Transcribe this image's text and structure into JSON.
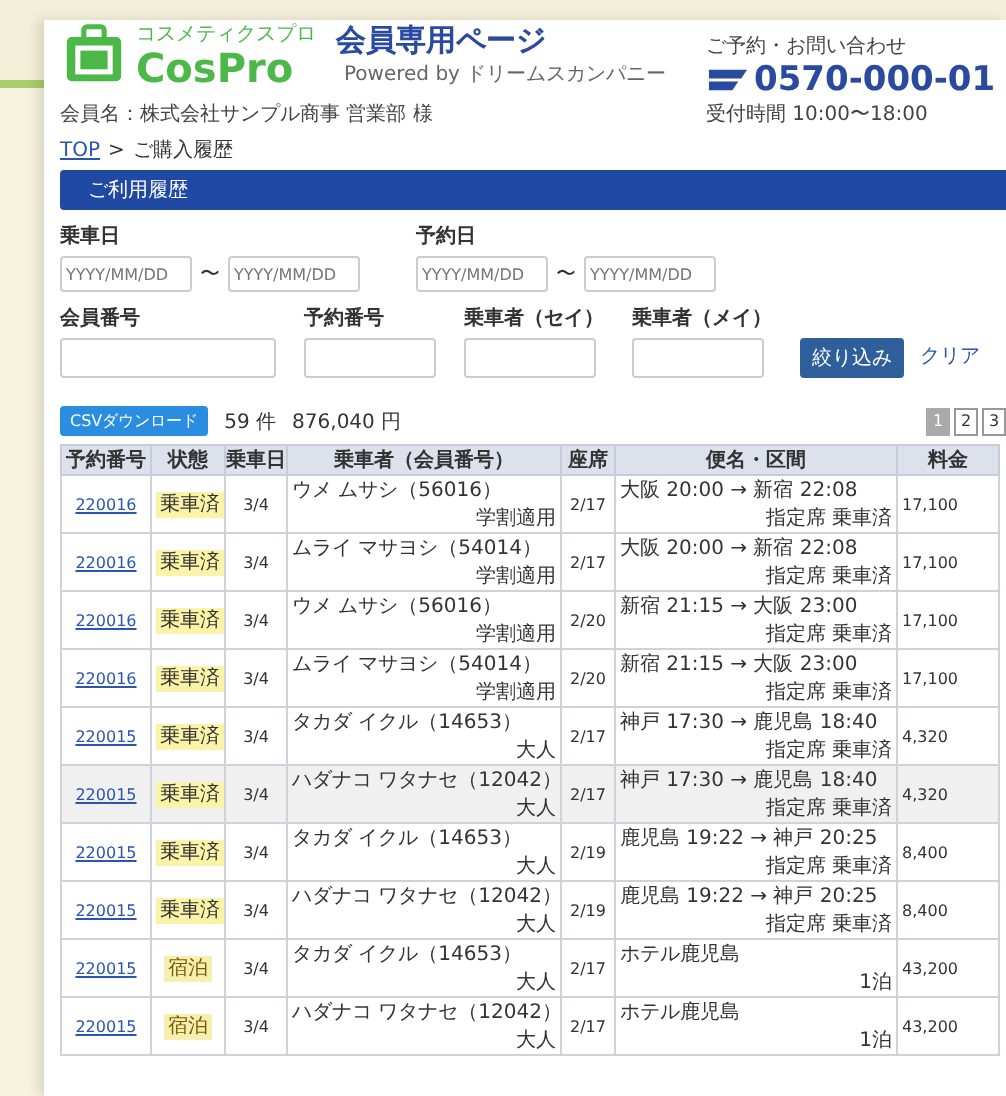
{
  "header": {
    "logo_tagline": "コスメティクスプロ",
    "logo": "CosPro",
    "title": "会員専用ページ",
    "powered": "Powered by ドリームスカンパニー",
    "member": "会員名：株式会社サンプル商事 営業部 様",
    "contact_label": "ご予約・お問い合わせ",
    "phone": "0570-000-01",
    "contact_note": "受付時間 10:00〜18:00"
  },
  "breadcrumb": [
    {
      "label": "TOP",
      "link": true
    },
    {
      "label": "ご購入履歴",
      "link": false
    }
  ],
  "breadcrumb_separator": ">",
  "section_title": "ご利用履歴",
  "filters": {
    "date_groups": [
      {
        "label": "乗車日",
        "from": {
          "placeholder": "YYYY/MM/DD"
        },
        "sep": "〜",
        "to": {
          "placeholder": "YYYY/MM/DD"
        }
      },
      {
        "label": "予約日",
        "from": {
          "placeholder": "YYYY/MM/DD"
        },
        "sep": "〜",
        "to": {
          "placeholder": "YYYY/MM/DD"
        }
      }
    ],
    "text_fields": [
      {
        "label": "会員番号"
      },
      {
        "label": "予約番号"
      },
      {
        "label": "乗車者（セイ）"
      },
      {
        "label": "乗車者（メイ）"
      }
    ],
    "search_button": "絞り込み",
    "clear_link": "クリア"
  },
  "summary": {
    "export_button": "CSVダウンロード",
    "count": "59 件",
    "total": "876,040 円"
  },
  "pagination": [
    {
      "label": "1",
      "selected": true
    },
    {
      "label": "2",
      "selected": false
    },
    {
      "label": "3",
      "selected": false
    }
  ],
  "table": {
    "columns": [
      "予約番号",
      "状態",
      "乗車日",
      "乗車者（会員番号）",
      "座席",
      "便名・区間",
      "料金"
    ],
    "rows": [
      {
        "id": "220016",
        "status": "乗車済",
        "kind": "done",
        "date": "3/4",
        "name": "ウメ ムサシ（56016）",
        "tag": "学割適用",
        "seat": "2/17",
        "route": "大阪 20:00 → 新宿 22:08",
        "route_note": "指定席 乗車済",
        "fare": "17,100",
        "highlighted": false
      },
      {
        "id": "220016",
        "status": "乗車済",
        "kind": "done",
        "date": "3/4",
        "name": "ムライ マサヨシ（54014）",
        "tag": "学割適用",
        "seat": "2/17",
        "route": "大阪 20:00 → 新宿 22:08",
        "route_note": "指定席 乗車済",
        "fare": "17,100",
        "highlighted": false
      },
      {
        "id": "220016",
        "status": "乗車済",
        "kind": "done",
        "date": "3/4",
        "name": "ウメ ムサシ（56016）",
        "tag": "学割適用",
        "seat": "2/20",
        "route": "新宿 21:15 → 大阪 23:00",
        "route_note": "指定席 乗車済",
        "fare": "17,100",
        "highlighted": false
      },
      {
        "id": "220016",
        "status": "乗車済",
        "kind": "done",
        "date": "3/4",
        "name": "ムライ マサヨシ（54014）",
        "tag": "学割適用",
        "seat": "2/20",
        "route": "新宿 21:15 → 大阪 23:00",
        "route_note": "指定席 乗車済",
        "fare": "17,100",
        "highlighted": false
      },
      {
        "id": "220015",
        "status": "乗車済",
        "kind": "done",
        "date": "3/4",
        "name": "タカダ イクル（14653）",
        "tag": "大人",
        "seat": "2/17",
        "route": "神戸 17:30 → 鹿児島 18:40",
        "route_note": "指定席 乗車済",
        "fare": "4,320",
        "highlighted": false
      },
      {
        "id": "220015",
        "status": "乗車済",
        "kind": "done",
        "date": "3/4",
        "name": "ハダナコ ワタナセ（12042）",
        "tag": "大人",
        "seat": "2/17",
        "route": "神戸 17:30 → 鹿児島 18:40",
        "route_note": "指定席 乗車済",
        "fare": "4,320",
        "highlighted": true
      },
      {
        "id": "220015",
        "status": "乗車済",
        "kind": "done",
        "date": "3/4",
        "name": "タカダ イクル（14653）",
        "tag": "大人",
        "seat": "2/19",
        "route": "鹿児島 19:22 → 神戸 20:25",
        "route_note": "指定席 乗車済",
        "fare": "8,400",
        "highlighted": false
      },
      {
        "id": "220015",
        "status": "乗車済",
        "kind": "done",
        "date": "3/4",
        "name": "ハダナコ ワタナセ（12042）",
        "tag": "大人",
        "seat": "2/19",
        "route": "鹿児島 19:22 → 神戸 20:25",
        "route_note": "指定席 乗車済",
        "fare": "8,400",
        "highlighted": false
      },
      {
        "id": "220015",
        "status": "宿泊",
        "kind": "stay",
        "date": "3/4",
        "name": "タカダ イクル（14653）",
        "tag": "大人",
        "seat": "2/17",
        "route": "ホテル鹿児島",
        "route_note": "1泊",
        "fare": "43,200",
        "highlighted": false
      },
      {
        "id": "220015",
        "status": "宿泊",
        "kind": "stay",
        "date": "3/4",
        "name": "ハダナコ ワタナセ（12042）",
        "tag": "大人",
        "seat": "2/17",
        "route": "ホテル鹿児島",
        "route_note": "1泊",
        "fare": "43,200",
        "highlighted": false
      }
    ]
  }
}
